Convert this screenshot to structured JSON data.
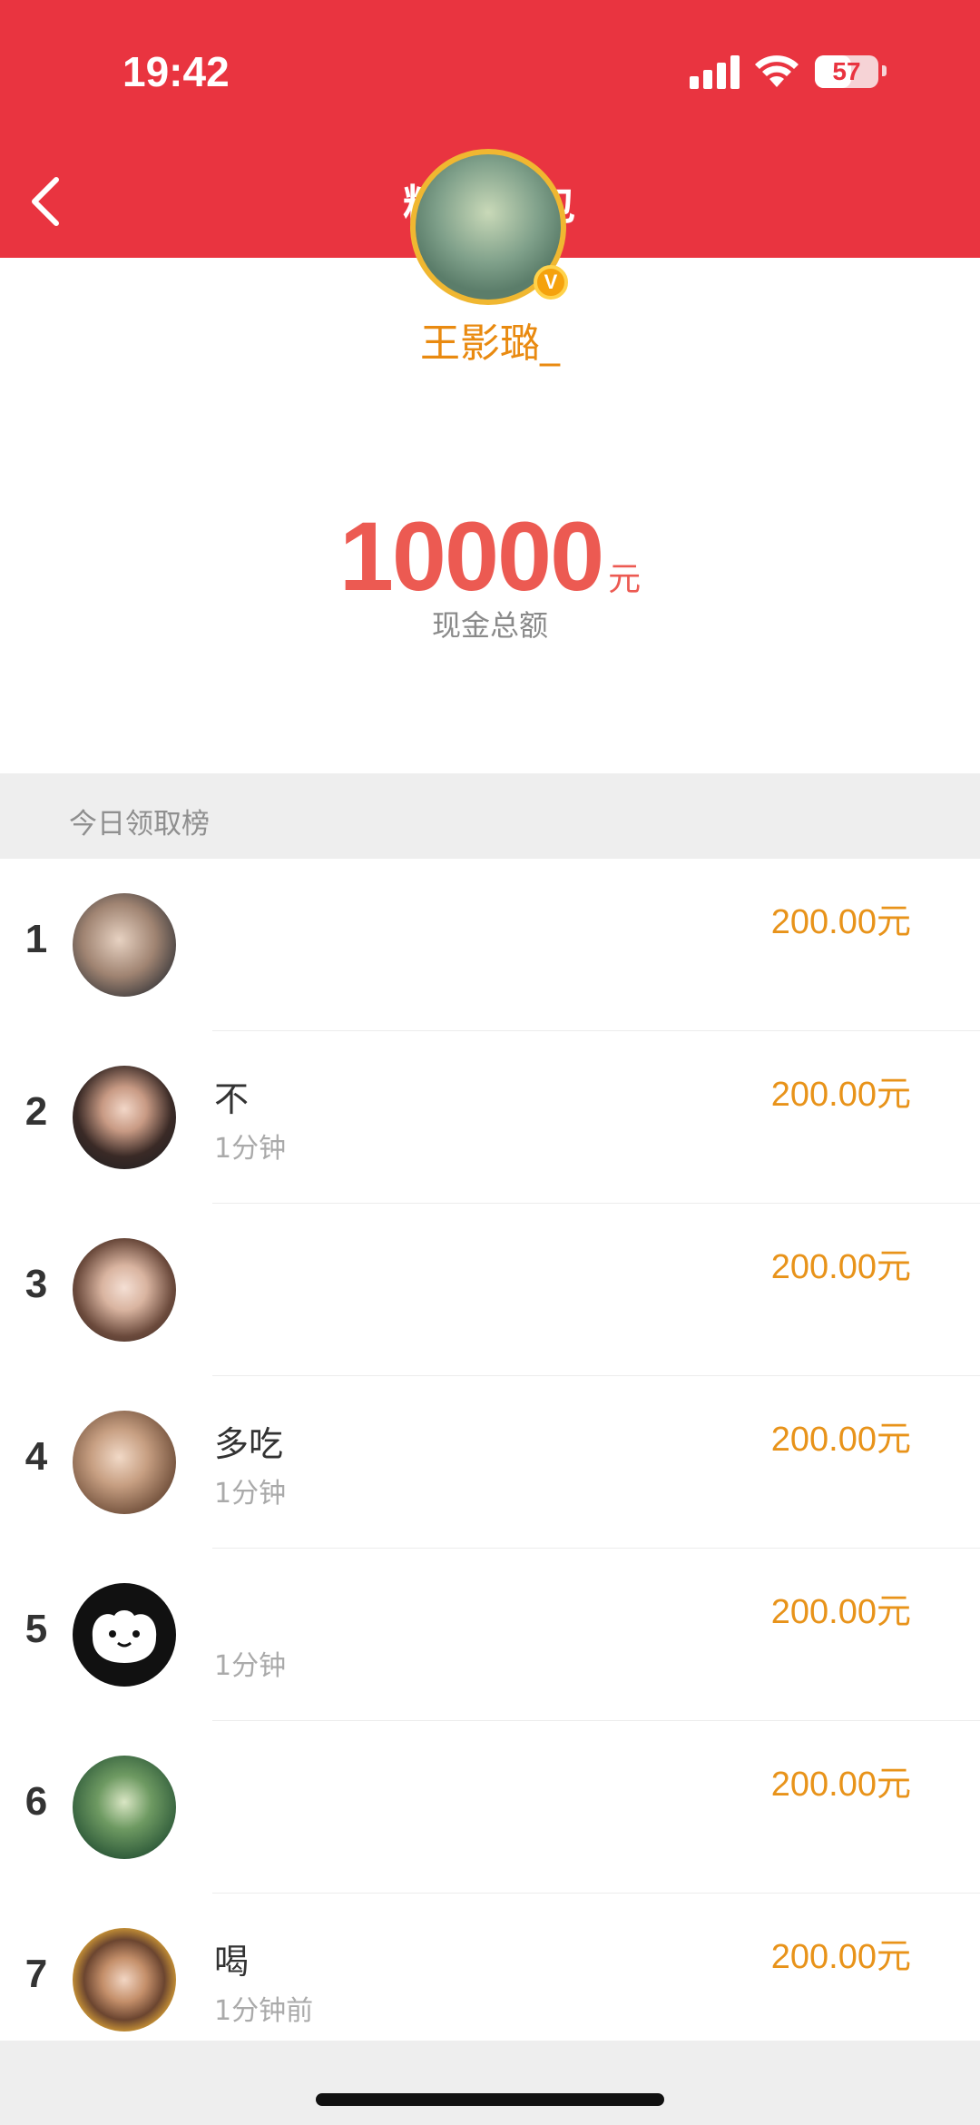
{
  "status_bar": {
    "time": "19:42",
    "battery": "57"
  },
  "nav": {
    "title": "粉丝红包"
  },
  "host": {
    "name": "王影璐_",
    "badge": "V"
  },
  "total": {
    "amount": "10000",
    "unit": "元",
    "label": "现金总额"
  },
  "ranking": {
    "title": "今日领取榜",
    "rows": [
      {
        "rank": "1",
        "name": "",
        "time": "",
        "amount": "200.00元"
      },
      {
        "rank": "2",
        "name": "不",
        "time": "1分钟",
        "amount": "200.00元"
      },
      {
        "rank": "3",
        "name": "",
        "time": "",
        "amount": "200.00元"
      },
      {
        "rank": "4",
        "name": "多吃",
        "time": "1分钟",
        "amount": "200.00元"
      },
      {
        "rank": "5",
        "name": "",
        "time": "1分钟",
        "amount": "200.00元"
      },
      {
        "rank": "6",
        "name": "",
        "time": "",
        "amount": "200.00元"
      },
      {
        "rank": "7",
        "name": "喝",
        "time": "1分钟前",
        "amount": "200.00元"
      }
    ]
  },
  "colors": {
    "nav_bg": "#e93440",
    "amount": "#ec5a52",
    "reward": "#e8931a",
    "host_name": "#e98a10"
  }
}
